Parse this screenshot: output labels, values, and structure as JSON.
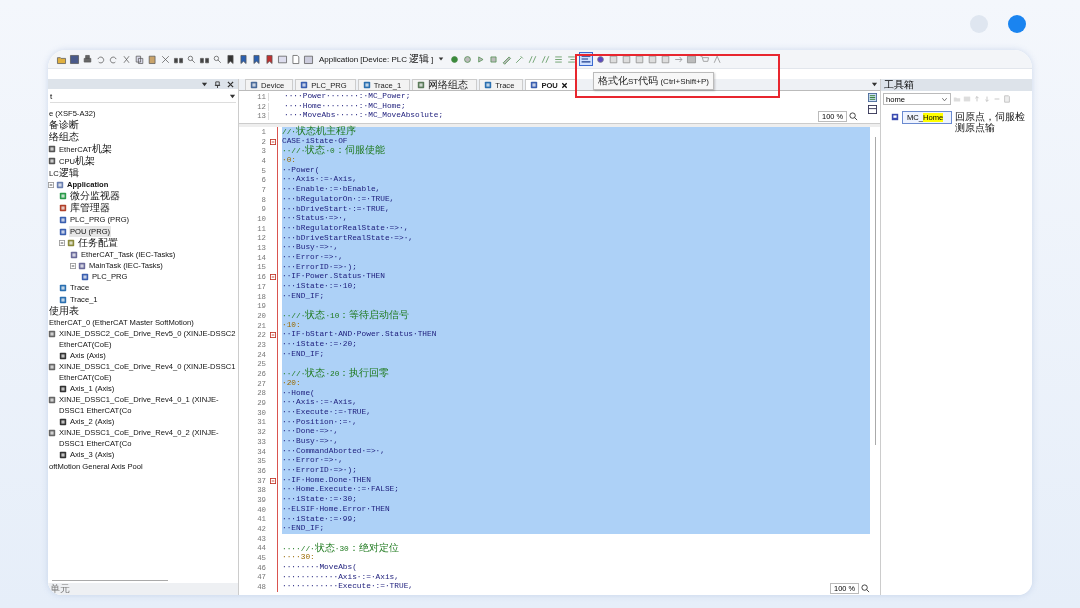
{
  "toolbar": {
    "target": "Application [Device: PLC逻辑]",
    "format_button": {
      "pressed": true
    },
    "tooltip": "格式化ST代码 (Ctrl+Shift+P)"
  },
  "device_tree": {
    "filter": "t",
    "items": [
      {
        "label": "e (XSF5-A32)",
        "selected": false
      },
      {
        "label": "备诊断",
        "selected": false
      },
      {
        "label": "络组态",
        "selected": false
      },
      {
        "label": "EtherCAT机架",
        "kind": "rack",
        "selected": false
      },
      {
        "label": "CPU机架",
        "kind": "rack",
        "selected": false
      },
      {
        "label": "LC逻辑",
        "selected": false
      },
      {
        "label": "Application",
        "kind": "app",
        "selected": false,
        "expanded": true,
        "children": [
          {
            "label": "微分监视器",
            "kind": "monitor",
            "selected": false
          },
          {
            "label": "库管理器",
            "kind": "library",
            "selected": false
          },
          {
            "label": "PLC_PRG (PRG)",
            "kind": "pou",
            "selected": false
          },
          {
            "label": "POU (PRG)",
            "kind": "pou",
            "selected": true
          },
          {
            "label": "任务配置",
            "kind": "tasks",
            "selected": false,
            "expanded": true,
            "children": [
              {
                "label": "EtherCAT_Task (IEC-Tasks)",
                "kind": "task",
                "selected": false
              },
              {
                "label": "MainTask (IEC-Tasks)",
                "kind": "task",
                "selected": false,
                "expanded": true,
                "children": [
                  {
                    "label": "PLC_PRG",
                    "kind": "pou",
                    "selected": false
                  }
                ]
              }
            ]
          },
          {
            "label": "Trace",
            "kind": "trace",
            "selected": false
          },
          {
            "label": "Trace_1",
            "kind": "trace",
            "selected": false
          }
        ]
      },
      {
        "label": "使用表",
        "selected": false
      },
      {
        "label": "EtherCAT_0 (EtherCAT Master SoftMotion)",
        "selected": false
      },
      {
        "label": "XINJE_DSSC2_CoE_Drive_Rev5_0 (XINJE-DSSC2 EtherCAT(CoE)",
        "kind": "drive",
        "selected": false,
        "children": [
          {
            "label": "Axis (Axis)",
            "kind": "axis",
            "selected": false
          }
        ]
      },
      {
        "label": "XINJE_DSSC1_CoE_Drive_Rev4_0 (XINJE-DSSC1 EtherCAT(CoE)",
        "kind": "drive",
        "selected": false,
        "children": [
          {
            "label": "Axis_1 (Axis)",
            "kind": "axis",
            "selected": false
          }
        ]
      },
      {
        "label": "XINJE_DSSC1_CoE_Drive_Rev4_0_1 (XINJE-DSSC1 EtherCAT(Co",
        "kind": "drive",
        "selected": false,
        "children": [
          {
            "label": "Axis_2 (Axis)",
            "kind": "axis",
            "selected": false
          }
        ]
      },
      {
        "label": "XINJE_DSSC1_CoE_Drive_Rev4_0_2 (XINJE-DSSC1 EtherCAT(Co",
        "kind": "drive",
        "selected": false,
        "children": [
          {
            "label": "Axis_3 (Axis)",
            "kind": "axis",
            "selected": false
          }
        ]
      },
      {
        "label": "oftMotion General Axis Pool",
        "selected": false
      }
    ],
    "footer": "单元"
  },
  "editor": {
    "tabs": [
      {
        "label": "Device",
        "kind": "device",
        "selected": false
      },
      {
        "label": "PLC_PRG",
        "kind": "pou",
        "selected": false
      },
      {
        "label": "Trace_1",
        "kind": "trace",
        "selected": false
      },
      {
        "label": "网络组态",
        "kind": "network",
        "selected": false
      },
      {
        "label": "Trace",
        "kind": "trace",
        "selected": false
      },
      {
        "label": "POU",
        "kind": "pou",
        "selected": true
      }
    ],
    "declaration": {
      "zoom": "100 %",
      "lines": [
        {
          "number": "11",
          "text": "····Power·······:·MC_Power;",
          "kind": "code"
        },
        {
          "number": "12",
          "text": "····Home········:·MC_Home;",
          "kind": "code"
        },
        {
          "number": "13",
          "text": "····MoveAbs·····:·MC_MoveAbsolute;",
          "kind": "code"
        }
      ]
    },
    "body": {
      "zoom": "100 %",
      "lines": [
        {
          "number": "1",
          "text": "//·状态机主程序",
          "kind": "comment",
          "selected": true
        },
        {
          "number": "2",
          "text": "CASE·iState·OF",
          "kind": "code",
          "selected": true,
          "fold": true
        },
        {
          "number": "3",
          "text": "··//·状态·0：伺服使能",
          "kind": "comment",
          "selected": true
        },
        {
          "number": "4",
          "text": "·0:",
          "kind": "number",
          "selected": true
        },
        {
          "number": "5",
          "text": "··Power(",
          "kind": "code",
          "selected": true
        },
        {
          "number": "6",
          "text": "···Axis·:=·Axis,",
          "kind": "code",
          "selected": true
        },
        {
          "number": "7",
          "text": "···Enable·:=·bEnable,",
          "kind": "code",
          "selected": true
        },
        {
          "number": "8",
          "text": "···bRegulatorOn·:=·TRUE,",
          "kind": "code",
          "selected": true
        },
        {
          "number": "9",
          "text": "···bDriveStart·:=·TRUE,",
          "kind": "code",
          "selected": true
        },
        {
          "number": "10",
          "text": "···Status·=>·,",
          "kind": "code",
          "selected": true
        },
        {
          "number": "11",
          "text": "···bRegulatorRealState·=>·,",
          "kind": "code",
          "selected": true
        },
        {
          "number": "12",
          "text": "···bDriveStartRealState·=>·,",
          "kind": "code",
          "selected": true
        },
        {
          "number": "13",
          "text": "···Busy·=>·,",
          "kind": "code",
          "selected": true
        },
        {
          "number": "14",
          "text": "···Error·=>·,",
          "kind": "code",
          "selected": true
        },
        {
          "number": "15",
          "text": "···ErrorID·=>·);",
          "kind": "code",
          "selected": true
        },
        {
          "number": "16",
          "text": "··IF·Power.Status·THEN",
          "kind": "code",
          "selected": true,
          "fold": true
        },
        {
          "number": "17",
          "text": "···iState·:=·10;",
          "kind": "code",
          "selected": true
        },
        {
          "number": "18",
          "text": "··END_IF;",
          "kind": "code",
          "selected": true
        },
        {
          "number": "19",
          "selected": true
        },
        {
          "number": "20",
          "text": "··//·状态·10：等待启动信号",
          "kind": "comment",
          "selected": true
        },
        {
          "number": "21",
          "text": "·10:",
          "kind": "number",
          "selected": true
        },
        {
          "number": "22",
          "text": "··IF·bStart·AND·Power.Status·THEN",
          "kind": "code",
          "selected": true,
          "fold": true
        },
        {
          "number": "23",
          "text": "···iState·:=·20;",
          "kind": "code",
          "selected": true
        },
        {
          "number": "24",
          "text": "··END_IF;",
          "kind": "code",
          "selected": true
        },
        {
          "number": "25",
          "selected": true
        },
        {
          "number": "26",
          "text": "··//·状态·20：执行回零",
          "kind": "comment",
          "selected": true
        },
        {
          "number": "27",
          "text": "·20:",
          "kind": "number",
          "selected": true
        },
        {
          "number": "28",
          "text": "··Home(",
          "kind": "code",
          "selected": true
        },
        {
          "number": "29",
          "text": "···Axis·:=·Axis,",
          "kind": "code",
          "selected": true
        },
        {
          "number": "30",
          "text": "···Execute·:=·TRUE,",
          "kind": "code",
          "selected": true
        },
        {
          "number": "31",
          "text": "···Position·:=·,",
          "kind": "code",
          "selected": true
        },
        {
          "number": "32",
          "text": "···Done·=>·,",
          "kind": "code",
          "selected": true
        },
        {
          "number": "33",
          "text": "···Busy·=>·,",
          "kind": "code",
          "selected": true
        },
        {
          "number": "34",
          "text": "···CommandAborted·=>·,",
          "kind": "code",
          "selected": true
        },
        {
          "number": "35",
          "text": "···Error·=>·,",
          "kind": "code",
          "selected": true
        },
        {
          "number": "36",
          "text": "···ErrorID·=>·);",
          "kind": "code",
          "selected": true
        },
        {
          "number": "37",
          "text": "··IF·Home.Done·THEN",
          "kind": "code",
          "selected": true,
          "fold": true
        },
        {
          "number": "38",
          "text": "···Home.Execute·:=·FALSE;",
          "kind": "code",
          "selected": true
        },
        {
          "number": "39",
          "text": "···iState·:=·30;",
          "kind": "code",
          "selected": true
        },
        {
          "number": "40",
          "text": "··ELSIF·Home.Error·THEN",
          "kind": "code",
          "selected": true
        },
        {
          "number": "41",
          "text": "···iState·:=·99;",
          "kind": "code",
          "selected": true
        },
        {
          "number": "42",
          "text": "··END_IF;",
          "kind": "code",
          "selected": true
        },
        {
          "number": "43",
          "selected": false
        },
        {
          "number": "44",
          "text": "····//·状态·30：绝对定位",
          "kind": "comment",
          "selected": false
        },
        {
          "number": "45",
          "text": "····30:",
          "kind": "number",
          "selected": false
        },
        {
          "number": "46",
          "text": "········MoveAbs(",
          "kind": "code",
          "selected": false
        },
        {
          "number": "47",
          "text": "············Axis·:=·Axis,",
          "kind": "code",
          "selected": false
        },
        {
          "number": "48",
          "text": "············Execute·:=·TRUE,",
          "kind": "code",
          "selected": false
        }
      ]
    }
  },
  "toolbox": {
    "title": "工具箱",
    "search": "home",
    "results": [
      {
        "name": "MC_",
        "match": "Home",
        "description": "回原点，伺服检测原点输",
        "selected": true
      }
    ]
  }
}
